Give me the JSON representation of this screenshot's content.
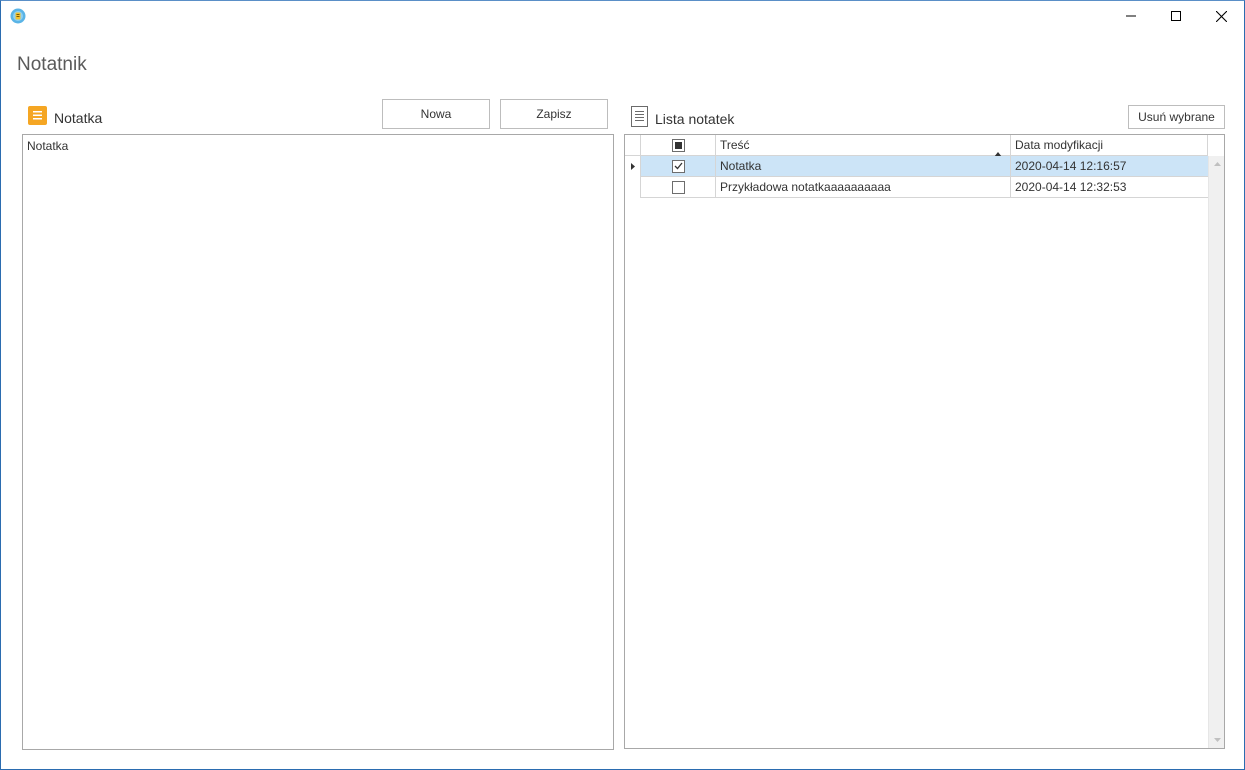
{
  "window": {
    "icon": "app-logo-icon",
    "controls": {
      "minimize": "minimize-icon",
      "maximize": "maximize-icon",
      "close": "close-icon"
    }
  },
  "app": {
    "title": "Notatnik"
  },
  "note_panel": {
    "header_label": "Notatka",
    "header_icon": "note-icon",
    "new_button": "Nowa",
    "save_button": "Zapisz",
    "editor_value": "Notatka",
    "accent_color": "#f5a623"
  },
  "list_panel": {
    "header_label": "Lista notatek",
    "header_icon": "document-icon",
    "delete_button": "Usuń wybrane",
    "columns": {
      "content": "Treść",
      "modified": "Data modyfikacji"
    },
    "sort": {
      "column": "content",
      "direction": "ascending"
    },
    "header_checkbox_state": "indeterminate",
    "rows": [
      {
        "checked": true,
        "content": "Notatka",
        "modified": "2020-04-14 12:16:57",
        "selected": true,
        "current": true
      },
      {
        "checked": false,
        "content": "Przykładowa notatkaaaaaaaaaa",
        "modified": "2020-04-14 12:32:53",
        "selected": false,
        "current": false
      }
    ],
    "selection_color": "#cce4f7"
  }
}
